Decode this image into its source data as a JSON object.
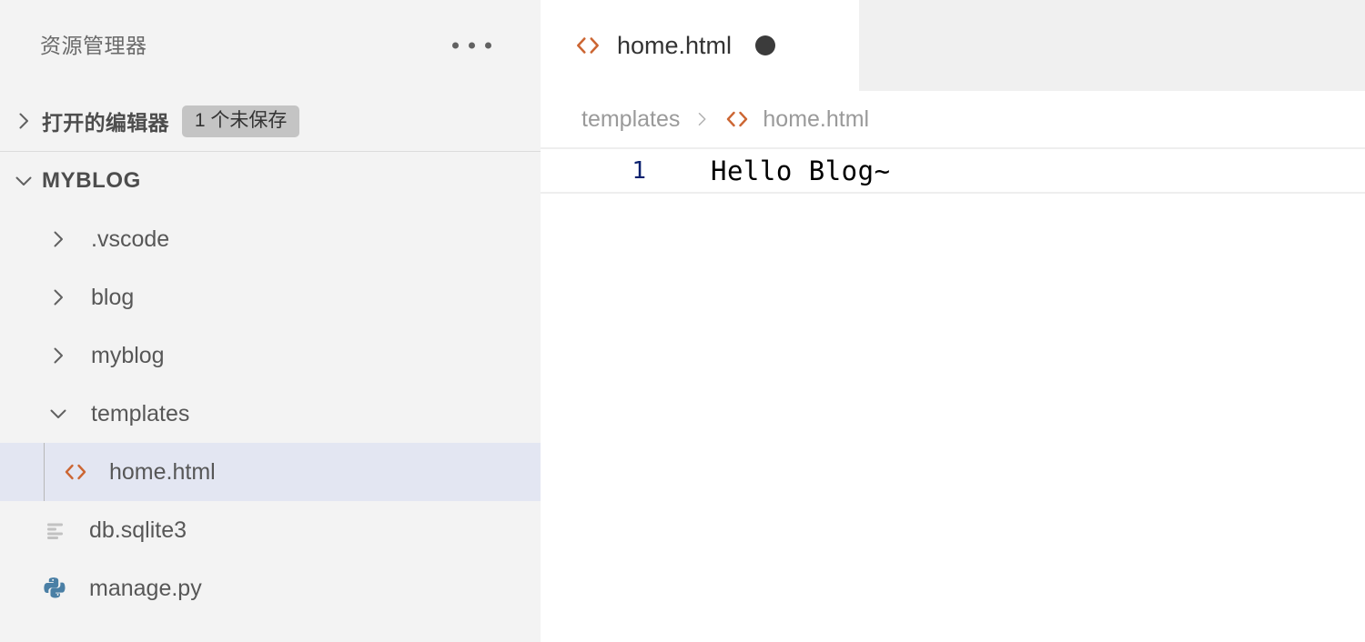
{
  "sidebar": {
    "title": "资源管理器",
    "more_menu_label": "...",
    "open_editors": {
      "label": "打开的编辑器",
      "badge": "1 个未保存",
      "expanded": false
    },
    "workspace": {
      "label": "MYBLOG",
      "expanded": true
    },
    "tree": [
      {
        "label": ".vscode",
        "type": "folder",
        "expanded": false,
        "icon": "chevron-right-icon",
        "selected": false
      },
      {
        "label": "blog",
        "type": "folder",
        "expanded": false,
        "icon": "chevron-right-icon",
        "selected": false
      },
      {
        "label": "myblog",
        "type": "folder",
        "expanded": false,
        "icon": "chevron-right-icon",
        "selected": false
      },
      {
        "label": "templates",
        "type": "folder",
        "expanded": true,
        "icon": "chevron-down-icon",
        "selected": false
      },
      {
        "label": "home.html",
        "type": "file",
        "icon": "html-file-icon",
        "selected": true
      },
      {
        "label": "db.sqlite3",
        "type": "file",
        "icon": "database-file-icon",
        "selected": false
      },
      {
        "label": "manage.py",
        "type": "file",
        "icon": "python-file-icon",
        "selected": false
      }
    ]
  },
  "editor": {
    "tab": {
      "title": "home.html",
      "icon": "html-file-icon",
      "dirty": true,
      "active": true
    },
    "breadcrumbs": [
      {
        "label": "templates",
        "icon": null
      },
      {
        "label": "home.html",
        "icon": "html-file-icon"
      }
    ],
    "breadcrumb_separator": "›",
    "code": {
      "lines": [
        {
          "number": "1",
          "text": "Hello Blog~"
        }
      ]
    }
  },
  "colors": {
    "sidebar_bg": "#f3f3f3",
    "editor_bg": "#ffffff",
    "tabbar_bg": "#f0f0f0",
    "selection_bg": "#e3e6f2",
    "html_icon": "#cc6633",
    "python_icon": "#4a7fa5",
    "line_number": "#0b216f",
    "badge_bg": "#c4c4c4",
    "text_primary": "#575757",
    "text_muted": "#9a9a9a"
  }
}
